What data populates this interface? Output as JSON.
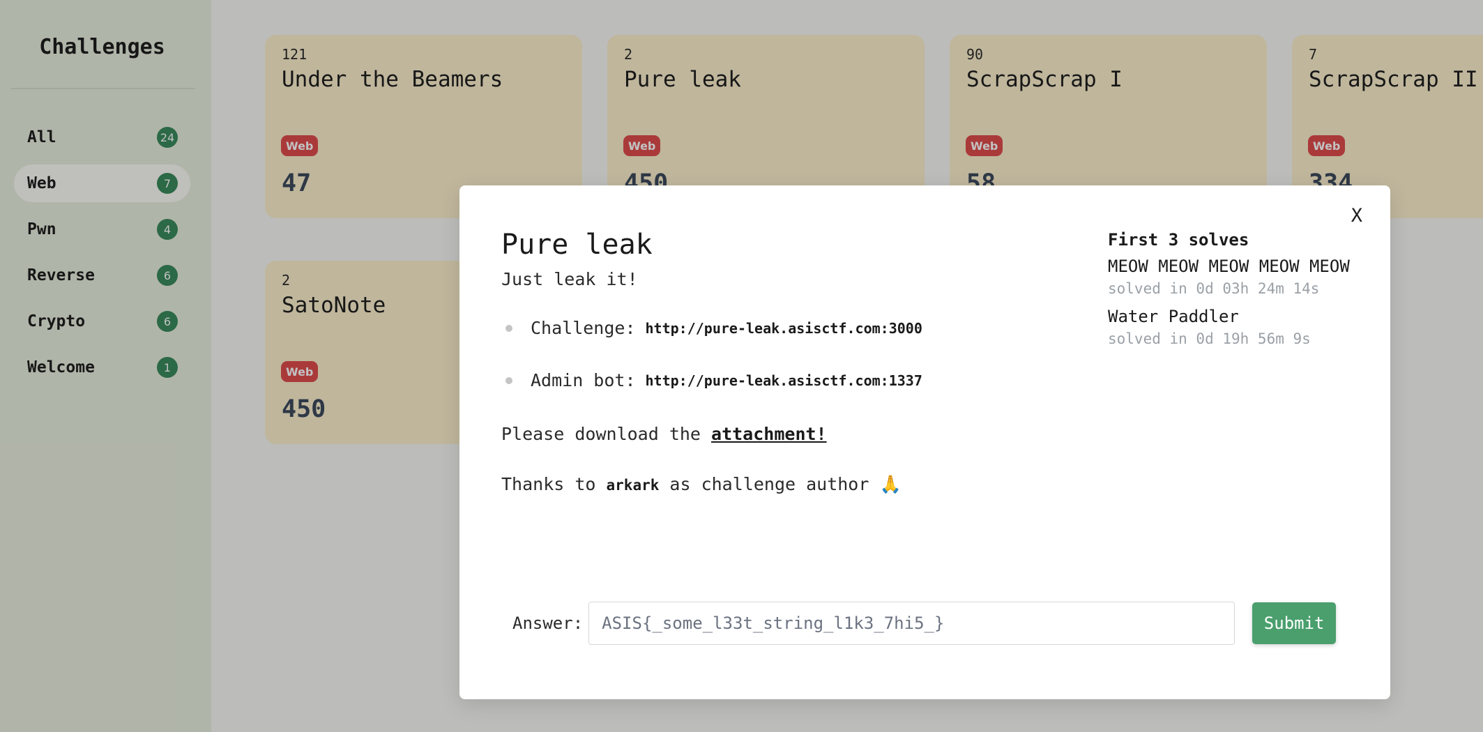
{
  "sidebar": {
    "title": "Challenges",
    "categories": [
      {
        "label": "All",
        "count": "24"
      },
      {
        "label": "Web",
        "count": "7"
      },
      {
        "label": "Pwn",
        "count": "4"
      },
      {
        "label": "Reverse",
        "count": "6"
      },
      {
        "label": "Crypto",
        "count": "6"
      },
      {
        "label": "Welcome",
        "count": "1"
      }
    ],
    "active_category": "Web"
  },
  "challenges": [
    {
      "solves": "121",
      "name": "Under the Beamers",
      "tag": "Web",
      "points": "47"
    },
    {
      "solves": "2",
      "name": "Pure leak",
      "tag": "Web",
      "points": "450"
    },
    {
      "solves": "90",
      "name": "ScrapScrap I",
      "tag": "Web",
      "points": "58"
    },
    {
      "solves": "7",
      "name": "ScrapScrap II",
      "tag": "Web",
      "points": "334"
    },
    {
      "solves": "2",
      "name": "SatoNote",
      "tag": "Web",
      "points": "450"
    }
  ],
  "modal": {
    "close_label": "X",
    "title": "Pure leak",
    "subtitle": "Just leak it!",
    "links": [
      {
        "label": "Challenge:",
        "url": "http://pure-leak.asisctf.com:3000"
      },
      {
        "label": "Admin bot:",
        "url": "http://pure-leak.asisctf.com:1337"
      }
    ],
    "download_prefix": "Please download the ",
    "download_link": "attachment!",
    "thanks_prefix": "Thanks to ",
    "author": "arkark",
    "thanks_suffix": " as challenge author 🙏",
    "solves_heading": "First 3 solves",
    "solvers": [
      {
        "name": "MEOW MEOW MEOW MEOW MEOW",
        "time": "solved in 0d 03h 24m 14s"
      },
      {
        "name": "Water Paddler",
        "time": "solved in 0d 19h 56m 9s"
      }
    ],
    "answer_label": "Answer:",
    "answer_placeholder": "ASIS{_some_l33t_string_l1k3_7hi5_}",
    "submit_label": "Submit"
  },
  "colors": {
    "sidebar_bg": "#e8eede",
    "card_bg": "#fbefce",
    "badge_green": "#3b8a5c",
    "tag_red": "#e04d4d",
    "submit_green": "#4a9f6d"
  }
}
